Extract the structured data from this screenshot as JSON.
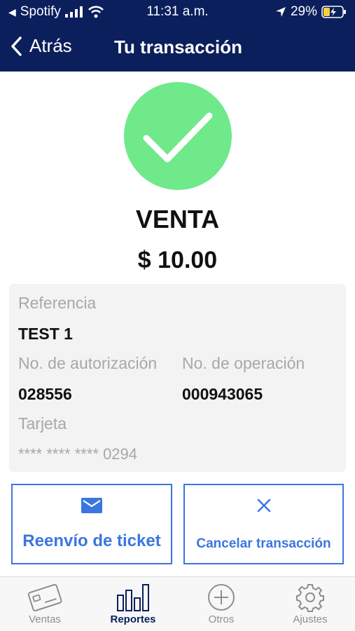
{
  "status_bar": {
    "carrier": "Spotify",
    "time": "11:31 a.m.",
    "battery": "29%"
  },
  "nav": {
    "back_label": "Atrás",
    "title": "Tu transacción"
  },
  "transaction": {
    "type": "VENTA",
    "amount": "$ 10.00"
  },
  "details": {
    "reference_label": "Referencia",
    "reference_value": "TEST 1",
    "authorization_label": "No. de autorización",
    "authorization_value": "028556",
    "operation_label": "No. de operación",
    "operation_value": "000943065",
    "card_label": "Tarjeta",
    "card_value": "**** **** **** 0294"
  },
  "actions": {
    "resend_label": "Reenvío de ticket",
    "cancel_label": "Cancelar transacción"
  },
  "tabs": [
    {
      "label": "Ventas",
      "icon": "card-icon",
      "active": false
    },
    {
      "label": "Reportes",
      "icon": "bar-chart-icon",
      "active": true
    },
    {
      "label": "Otros",
      "icon": "plus-circle-icon",
      "active": false
    },
    {
      "label": "Ajustes",
      "icon": "gear-icon",
      "active": false
    }
  ],
  "colors": {
    "header": "#0b1f5c",
    "success": "#6fe98a",
    "accent": "#3b76e0",
    "panel": "#f3f3f3"
  }
}
